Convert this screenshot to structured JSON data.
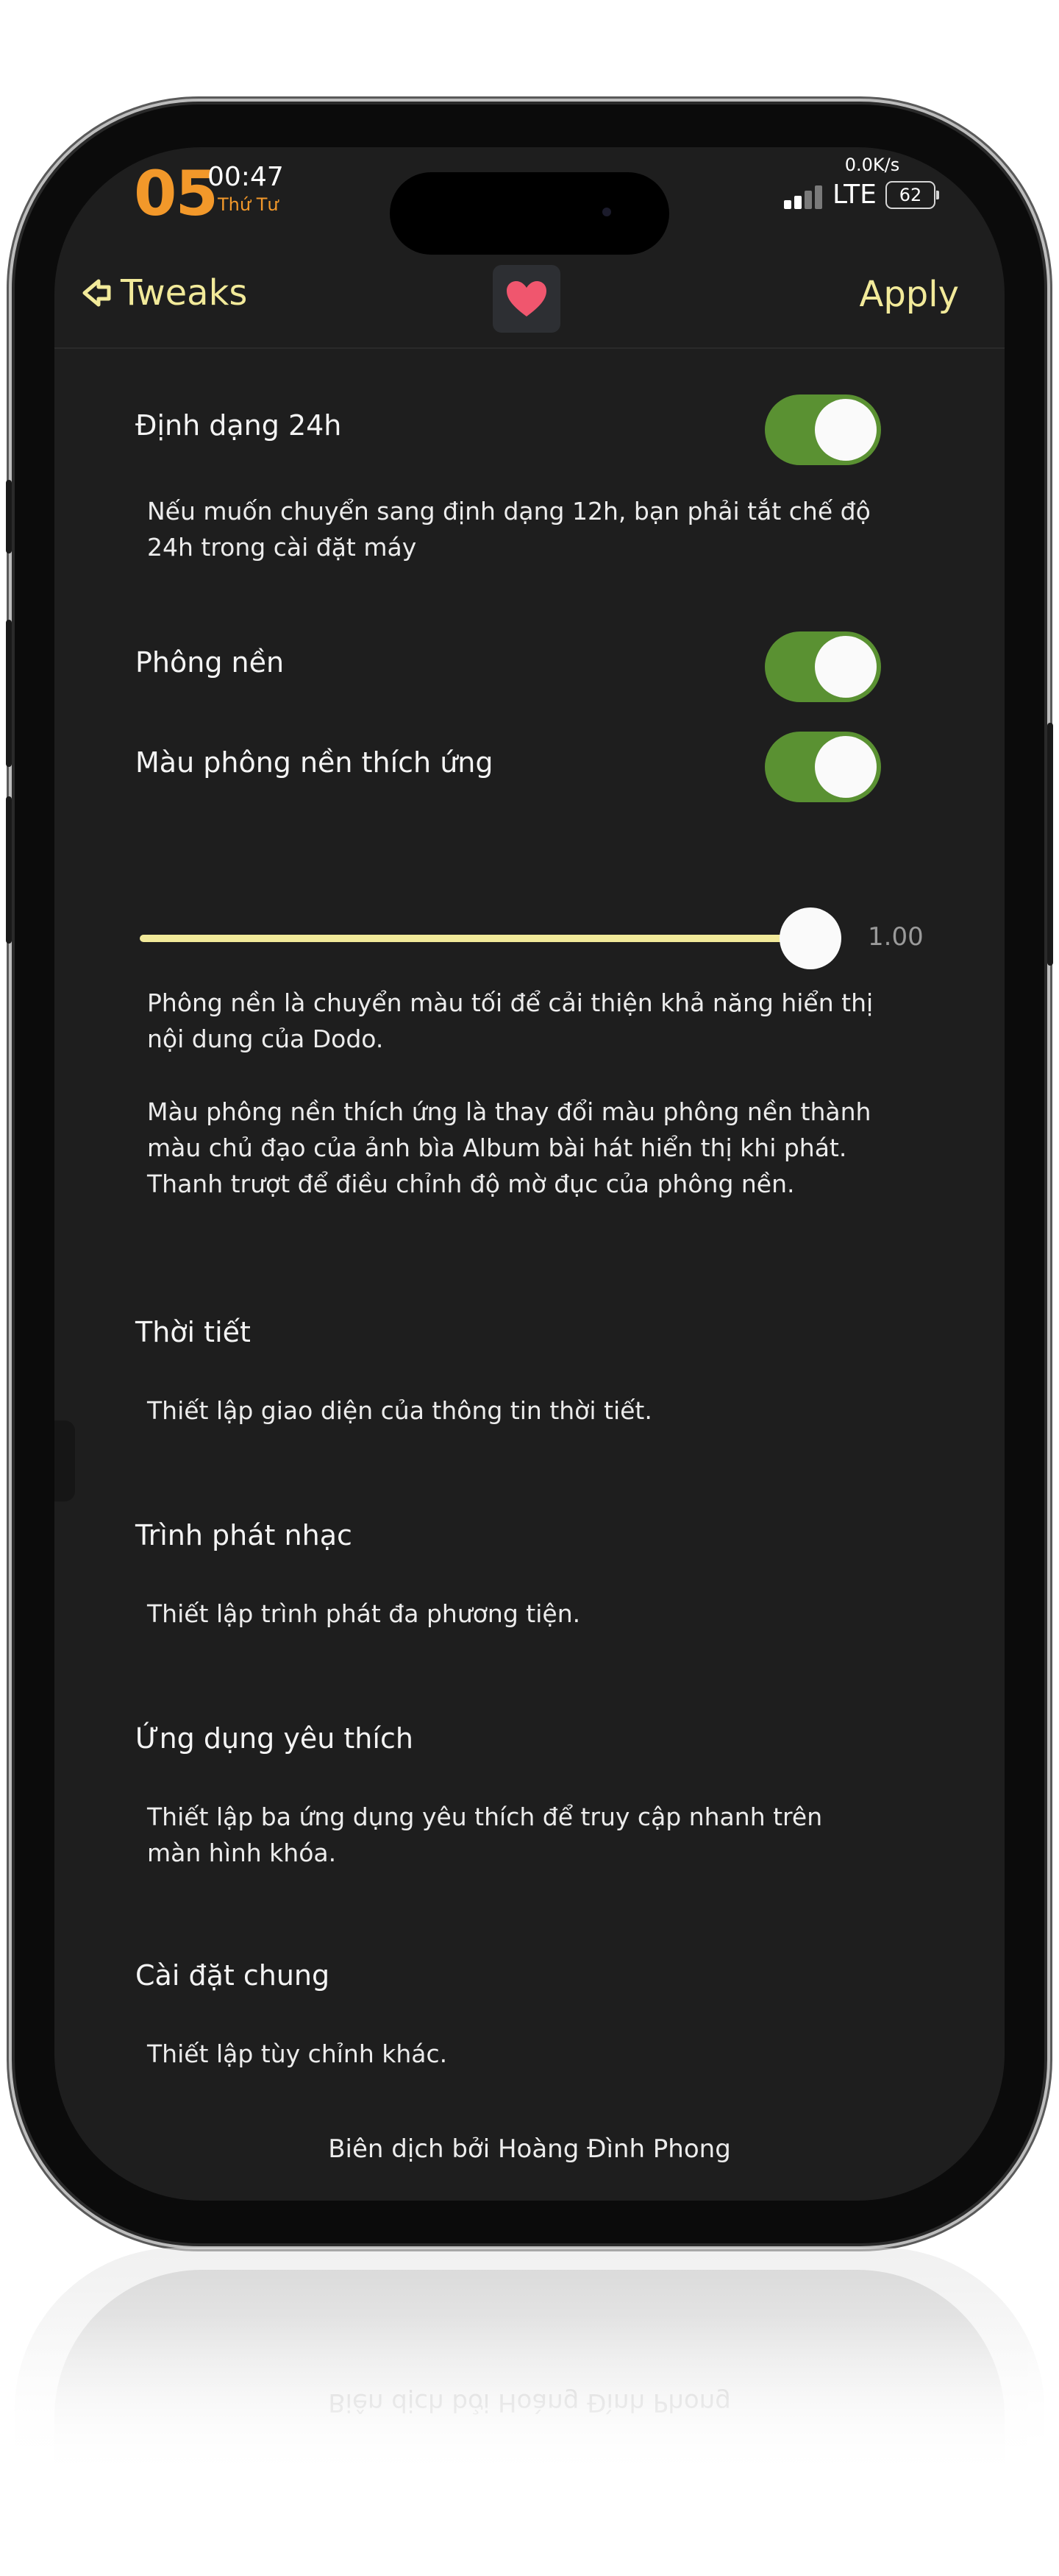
{
  "status_bar": {
    "hour": "05",
    "minute": "00:47",
    "day": "Thứ Tư",
    "net_speed": "0.0K/s",
    "network": "LTE",
    "battery": "62"
  },
  "nav": {
    "back_label": "Tweaks",
    "apply_label": "Apply"
  },
  "settings": {
    "format24h": {
      "label": "Định dạng 24h",
      "enabled": true,
      "description": "Nếu muốn chuyển sang định dạng 12h, bạn phải tắt chế độ 24h trong cài đặt máy"
    },
    "background": {
      "label": "Phông nền",
      "enabled": true
    },
    "adaptive_color": {
      "label": "Màu phông nền thích ứng",
      "enabled": true
    },
    "opacity_slider": {
      "value": 1.0,
      "value_label": "1.00"
    },
    "background_desc": "Phông nền là chuyển màu tối để cải thiện khả năng hiển thị nội dung của Dodo.",
    "adaptive_desc": "Màu phông nền thích ứng là thay đổi màu phông nền thành màu chủ đạo của ảnh bìa Album bài hát hiển thị khi phát. Thanh trượt để điều chỉnh độ mờ đục của phông nền."
  },
  "sections": [
    {
      "title": "Thời tiết",
      "description": "Thiết lập giao diện của thông tin thời tiết."
    },
    {
      "title": "Trình phát nhạc",
      "description": "Thiết lập trình phát đa phương tiện."
    },
    {
      "title": "Ứng dụng yêu thích",
      "description": "Thiết lập ba ứng dụng yêu thích để truy cập nhanh trên màn hình khóa."
    },
    {
      "title": "Cài đặt chung",
      "description": "Thiết lập tùy chỉnh khác."
    }
  ],
  "credits": "Biên dịch bởi Hoàng Đình Phong",
  "colors": {
    "accent_yellow": "#f2ea9a",
    "toggle_green": "#5a9132",
    "clock_orange": "#f2982a",
    "heart_red": "#f0566e",
    "background": "#1e1e1e"
  },
  "icons": {
    "back": "back-arrow-icon",
    "heart": "heart-icon",
    "signal": "signal-bars-icon"
  }
}
